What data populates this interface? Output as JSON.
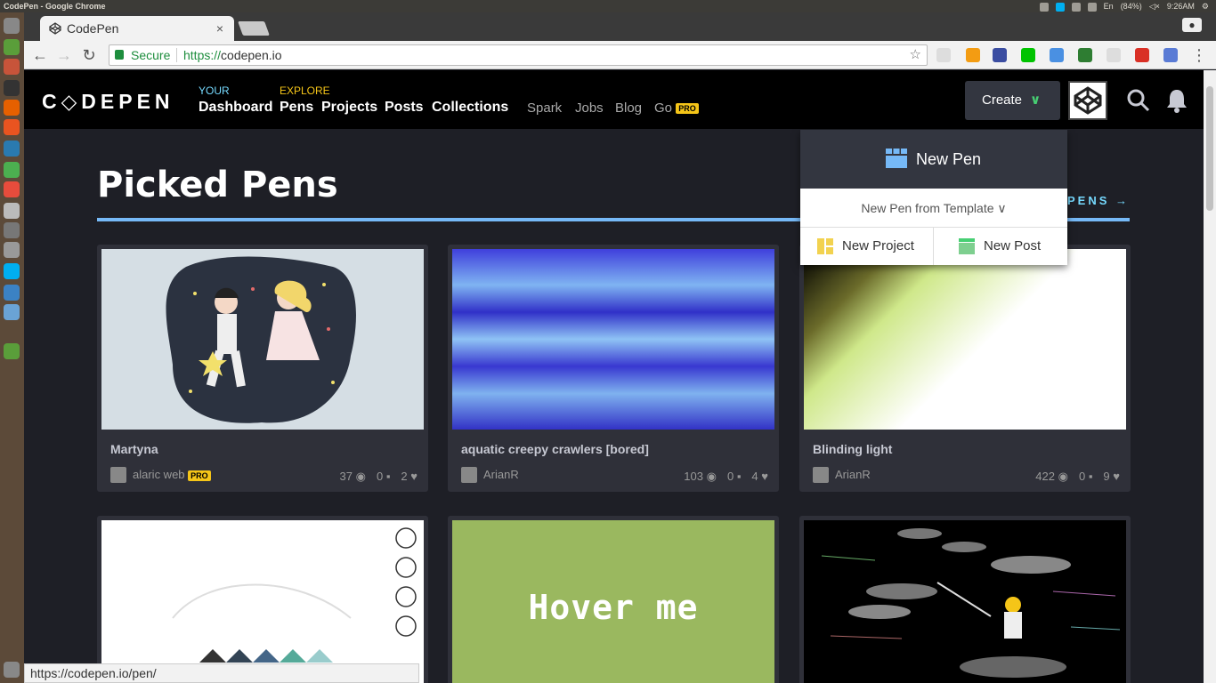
{
  "os": {
    "window_title": "CodePen - Google Chrome",
    "battery": "(84%)",
    "time": "9:26AM",
    "lang": "En"
  },
  "browser": {
    "tab_title": "CodePen",
    "tab_close": "×",
    "secure_label": "Secure",
    "url_scheme": "https://",
    "url_host": "codepen.io",
    "status_url": "https://codepen.io/pen/"
  },
  "header": {
    "logo": "C◇DEPEN",
    "your_label": "YOUR",
    "explore_label": "EXPLORE",
    "dashboard": "Dashboard",
    "pens": "Pens",
    "projects": "Projects",
    "posts": "Posts",
    "collections": "Collections",
    "spark": "Spark",
    "jobs": "Jobs",
    "blog": "Blog",
    "go": "Go",
    "pro": "PRO",
    "create": "Create"
  },
  "section": {
    "title": "Picked Pens",
    "more": "PENS"
  },
  "create_menu": {
    "new_pen": "New Pen",
    "from_template": "New Pen from Template",
    "new_project": "New Project",
    "new_post": "New Post"
  },
  "cards": [
    {
      "title": "Martyna",
      "author": "alaric web",
      "pro": "PRO",
      "views": "37",
      "comments": "0",
      "loves": "2"
    },
    {
      "title": "aquatic creepy crawlers [bored]",
      "author": "ArianR",
      "views": "103",
      "comments": "0",
      "loves": "4"
    },
    {
      "title": "Blinding light",
      "author": "ArianR",
      "views": "422",
      "comments": "0",
      "loves": "9"
    }
  ],
  "row2": {
    "hover_text": "Hover me"
  },
  "colors": {
    "accent_green": "#47cf73",
    "accent_blue": "#76b9f7",
    "pro_yellow": "#f5c518",
    "hover_card_bg": "#9ab85f"
  }
}
